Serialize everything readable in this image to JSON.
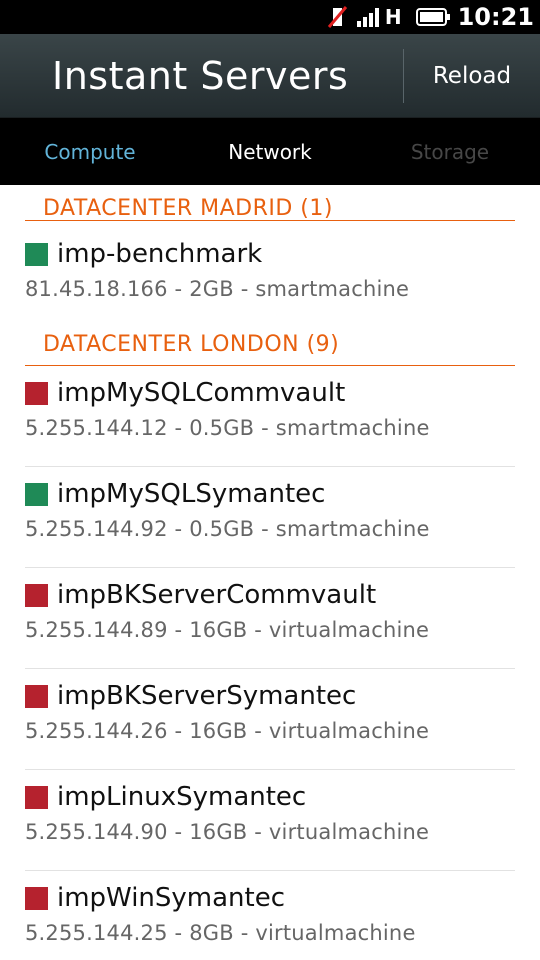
{
  "status_bar": {
    "network_type": "H",
    "time": "10:21",
    "icons": [
      "muted-icon",
      "signal-icon",
      "battery-icon"
    ]
  },
  "header": {
    "title": "Instant Servers",
    "reload_label": "Reload"
  },
  "tabs": [
    {
      "label": "Compute",
      "state": "active"
    },
    {
      "label": "Network",
      "state": "normal"
    },
    {
      "label": "Storage",
      "state": "disabled"
    }
  ],
  "colors": {
    "accent": "#e8600f",
    "running": "#1f8a57",
    "stopped": "#b5222e",
    "active_tab": "#62b4d9"
  },
  "datacenters": [
    {
      "title": "DATACENTER MADRID (1)",
      "servers": [
        {
          "name": "imp-benchmark",
          "details": "81.45.18.166 - 2GB - smartmachine",
          "status": "running"
        }
      ]
    },
    {
      "title": "DATACENTER LONDON (9)",
      "servers": [
        {
          "name": "impMySQLCommvault",
          "details": "5.255.144.12 - 0.5GB - smartmachine",
          "status": "stopped"
        },
        {
          "name": "impMySQLSymantec",
          "details": "5.255.144.92 - 0.5GB - smartmachine",
          "status": "running"
        },
        {
          "name": "impBKServerCommvault",
          "details": "5.255.144.89 - 16GB - virtualmachine",
          "status": "stopped"
        },
        {
          "name": "impBKServerSymantec",
          "details": "5.255.144.26 - 16GB - virtualmachine",
          "status": "stopped"
        },
        {
          "name": "impLinuxSymantec",
          "details": "5.255.144.90 - 16GB - virtualmachine",
          "status": "stopped"
        },
        {
          "name": "impWinSymantec",
          "details": "5.255.144.25 - 8GB - virtualmachine",
          "status": "stopped"
        }
      ]
    }
  ]
}
